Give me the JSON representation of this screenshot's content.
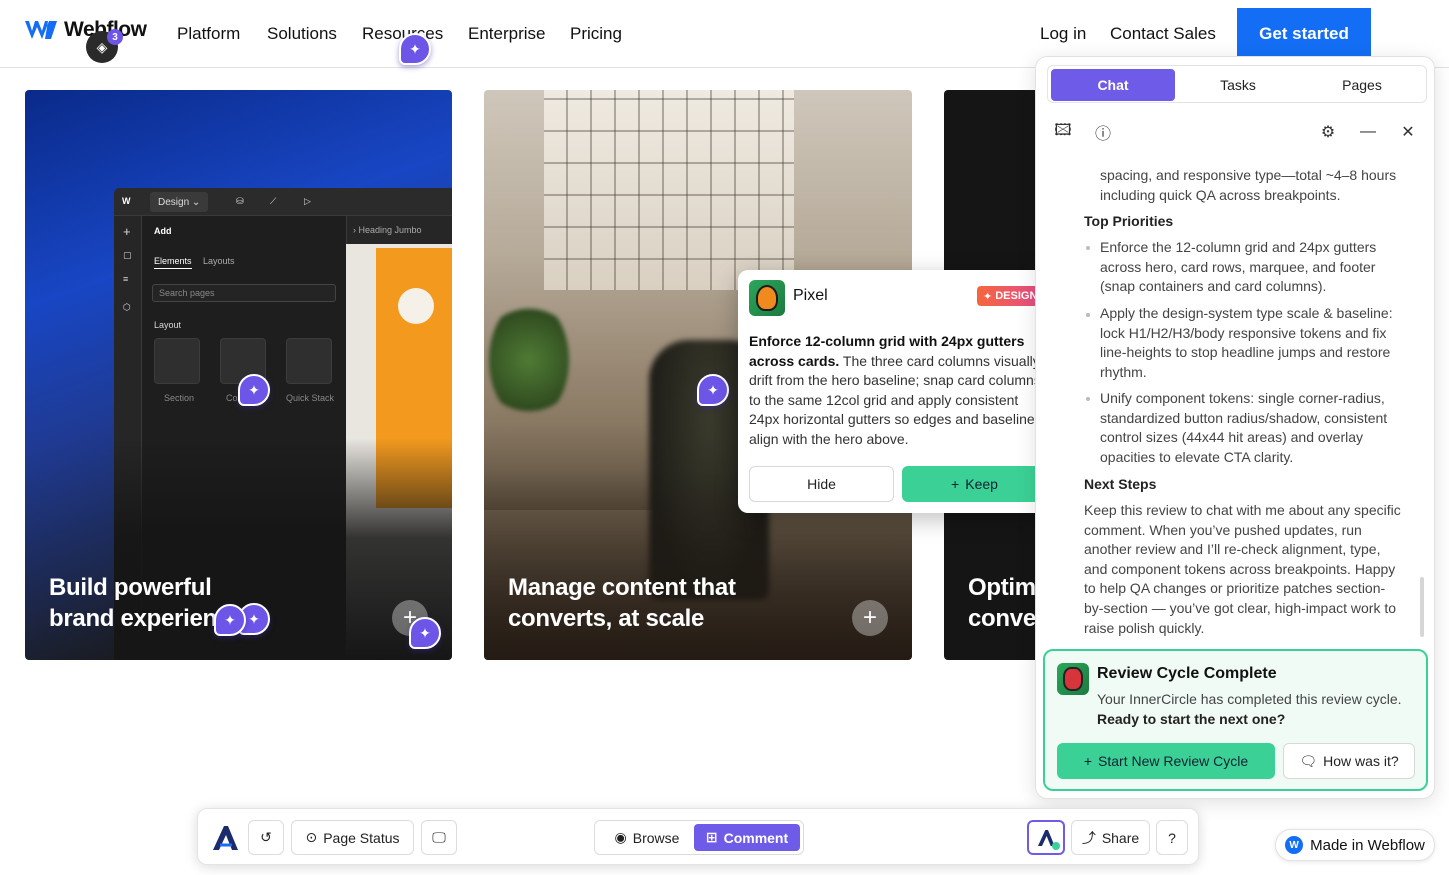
{
  "nav": {
    "logo_text": "Webflow",
    "links": [
      "Platform",
      "Solutions",
      "Resources",
      "Enterprise",
      "Pricing"
    ],
    "login": "Log in",
    "contact": "Contact Sales",
    "cta": "Get started",
    "layers_count": "3"
  },
  "cards": [
    {
      "title": "Build powerful\nbrand experien"
    },
    {
      "title": "Manage content that\nconverts, at scale"
    },
    {
      "title": "Optim\nconve"
    }
  ],
  "designer": {
    "mode": "Design",
    "panel_title": "Add",
    "tab_elements": "Elements",
    "tab_layouts": "Layouts",
    "search_placeholder": "Search pages",
    "section_label": "Layout",
    "tiles": [
      "Section",
      "Co",
      "Quick Stack"
    ],
    "breadcrumb": "Heading Jumbo"
  },
  "popup": {
    "name": "Pixel",
    "tag": "DESIGN",
    "body_bold": "Enforce 12-column grid with 24px gutters across cards.",
    "body_rest": " The three card columns visually drift from the hero baseline; snap card columns to the same 12col grid and apply consistent 24px horizontal gutters so edges and baselines align with the hero above.",
    "hide": "Hide",
    "keep": "Keep"
  },
  "panel": {
    "tabs": [
      "Chat",
      "Tasks",
      "Pages"
    ],
    "active_tab": "Chat",
    "intro": "spacing, and responsive type—total ~4–8 hours including quick QA across breakpoints.",
    "priorities_heading": "Top Priorities",
    "priorities": [
      "Enforce the 12-column grid and 24px gutters across hero, card rows, marquee, and footer (snap containers and card columns).",
      "Apply the design-system type scale & baseline: lock H1/H2/H3/body responsive tokens and fix line-heights to stop headline jumps and restore rhythm.",
      "Unify component tokens: single corner-radius, standardized button radius/shadow, consistent control sizes (44x44 hit areas) and overlay opacities to elevate CTA clarity."
    ],
    "next_heading": "Next Steps",
    "next_text": "Keep this review to chat with me about any specific comment. When you’ve pushed updates, run another review and I’ll re-check alignment, type, and component tokens across breakpoints. Happy to help QA changes or prioritize patches section-by-section — you’ve got clear, high-impact work to raise polish quickly.",
    "review": {
      "title": "Review Cycle Complete",
      "text": "Your InnerCircle has completed this review cycle.",
      "question": "Ready to start the next one?",
      "start": "Start New Review Cycle",
      "feedback": "How was it?"
    }
  },
  "toolbar": {
    "page_status": "Page Status",
    "browse": "Browse",
    "comment": "Comment",
    "share": "Share"
  },
  "badge": {
    "made_in": "Made in Webflow"
  },
  "colors": {
    "accent": "#6e5ce8",
    "brand": "#146ef5",
    "success": "#3bd196"
  }
}
